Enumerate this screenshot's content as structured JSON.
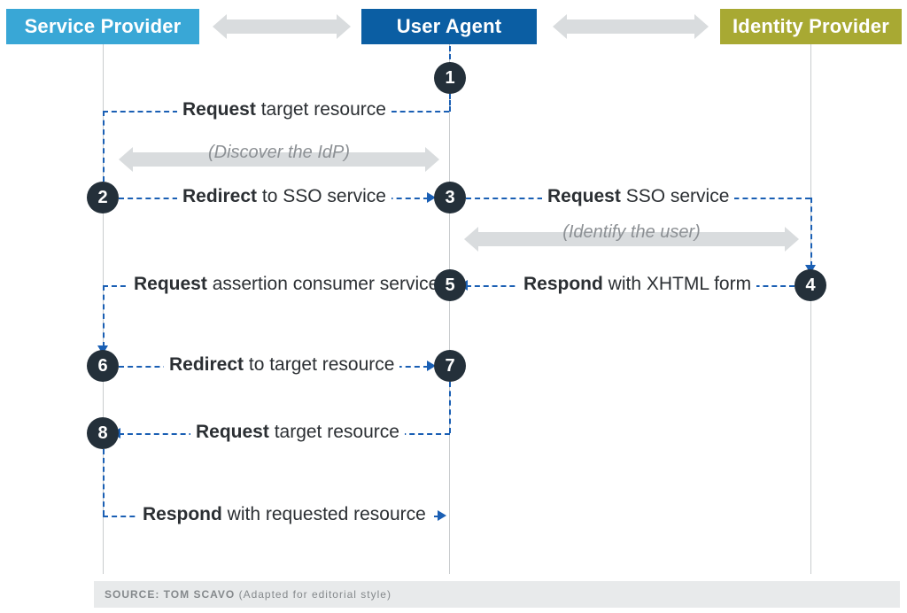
{
  "columns": {
    "sp": "Service Provider",
    "ua": "User Agent",
    "idp": "Identity Provider"
  },
  "notes": {
    "discover": "(Discover the IdP)",
    "identify": "(Identify the user)"
  },
  "steps": {
    "s1": "1",
    "s2": "2",
    "s3": "3",
    "s4": "4",
    "s5": "5",
    "s6": "6",
    "s7": "7",
    "s8": "8"
  },
  "labels": {
    "l1_b": "Request",
    "l1_r": " target resource",
    "l2_b": "Redirect",
    "l2_r": " to SSO service",
    "l3_b": "Request",
    "l3_r": " SSO service",
    "l4_b": "Respond",
    "l4_r": " with XHTML form",
    "l5_b": "Request",
    "l5_r": " assertion consumer service",
    "l6_b": "Redirect",
    "l6_r": " to target resource",
    "l8_b": "Request",
    "l8_r": " target resource",
    "l9_b": "Respond",
    "l9_r": " with requested resource"
  },
  "source": {
    "prefix": "SOURCE: ",
    "name": "TOM SCAVO",
    "suffix": " (Adapted for editorial style)"
  }
}
